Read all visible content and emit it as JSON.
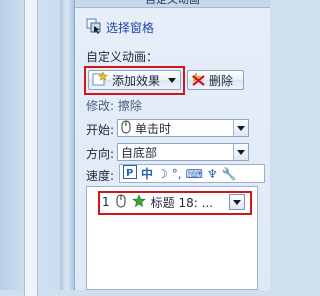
{
  "pane": {
    "title": "自定义动画",
    "select_pane_link": "选择窗格",
    "custom_animation_label": "自定义动画：",
    "add_effect_button": "添加效果",
    "delete_button": "删除",
    "modify_label": "修改: 擦除",
    "start": {
      "label": "开始:",
      "value": "单击时"
    },
    "direction": {
      "label": "方向:",
      "value": "自底部"
    },
    "speed": {
      "label": "速度:",
      "ime_items": [
        "中",
        "☽",
        "°,",
        "⌨",
        "♆",
        "🔧"
      ]
    },
    "list_item": {
      "index": "1",
      "title": "标题 18: ..."
    }
  },
  "colors": {
    "highlight": "#d4141b",
    "link": "#2246a8"
  }
}
